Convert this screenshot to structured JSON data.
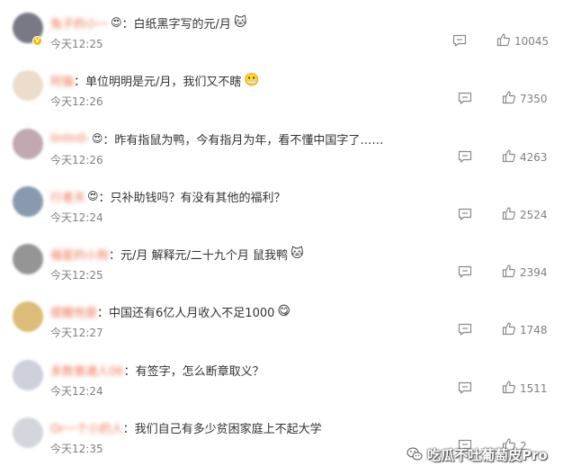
{
  "colors": {
    "username": "#eb7350",
    "meta": "#808080",
    "badge": "#f5b800"
  },
  "comments": [
    {
      "username": "兔子的小一",
      "badge_emoji": "😍",
      "text": "白纸黑字写的元/月",
      "text_emoji": "🐱",
      "time": "今天12:25",
      "likes": "10045",
      "verified": true,
      "avatar_color": "#6b6b7a"
    },
    {
      "username": "阿猫",
      "badge_emoji": "",
      "text": "单位明明是元/月，我们又不瞎",
      "text_emoji": "😬",
      "time": "今天12:26",
      "likes": "7350",
      "verified": false,
      "avatar_color": "#e9d9c7"
    },
    {
      "username": "linlin0-",
      "badge_emoji": "😍",
      "text": "昨有指鼠为鸭，今有指月为年，看不懂中国字了……",
      "text_emoji": "",
      "time": "今天12:26",
      "likes": "4263",
      "verified": false,
      "avatar_color": "#b7a1a8"
    },
    {
      "username": "行者天",
      "badge_emoji": "😍",
      "text": "只补助钱吗？有没有其他的福利？",
      "text_emoji": "",
      "time": "今天12:24",
      "likes": "2524",
      "verified": false,
      "avatar_color": "#7d8fa8"
    },
    {
      "username": "福星的小狗",
      "badge_emoji": "",
      "text": "元/月 解释元/二十九个月 鼠我鸭",
      "text_emoji": "🐱",
      "time": "今天12:25",
      "likes": "2394",
      "verified": false,
      "avatar_color": "#8a8a8a"
    },
    {
      "username": "提醒他是",
      "badge_emoji": "",
      "text": "中国还有6亿人月收入不足1000",
      "text_emoji": "😋",
      "time": "今天12:27",
      "likes": "1748",
      "verified": false,
      "avatar_color": "#d8b56a"
    },
    {
      "username": "多数普通人06",
      "badge_emoji": "",
      "text": "有签字，怎么断章取义？",
      "text_emoji": "",
      "time": "今天12:24",
      "likes": "1511",
      "verified": false,
      "avatar_color": "#c9cbd6"
    },
    {
      "username": "Or一个小的人",
      "badge_emoji": "",
      "text": "我们自己有多少贫困家庭上不起大学",
      "text_emoji": "",
      "time": "今天12:35",
      "likes": "2",
      "verified": false,
      "avatar_color": "#cfd3da"
    }
  ],
  "icons": {
    "reply": "comment-icon",
    "like": "thumbs-up-icon",
    "wechat": "wechat-icon"
  },
  "watermark": {
    "text": "吃瓜不吐葡萄皮Pro"
  }
}
